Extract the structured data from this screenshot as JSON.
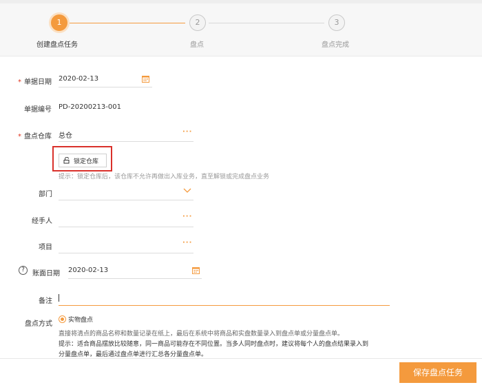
{
  "steps": [
    {
      "number": "1",
      "label": "创建盘点任务"
    },
    {
      "number": "2",
      "label": "盘点"
    },
    {
      "number": "3",
      "label": "盘点完成"
    }
  ],
  "colors": {
    "accent": "#f49a3d",
    "required": "#e0341e",
    "highlight": "#d9302a"
  },
  "form": {
    "required_mark": "*",
    "doc_date": {
      "label": "单据日期",
      "value": "2020-02-13",
      "icon": "calendar-icon"
    },
    "doc_no": {
      "label": "单据编号",
      "value": "PD-20200213-001"
    },
    "warehouse": {
      "label": "盘点仓库",
      "value": "总仓",
      "more": "···"
    },
    "lock_button": {
      "label": "锁定仓库",
      "icon": "lock-icon"
    },
    "lock_hint": "提示：锁定仓库后，该仓库不允许再做出入库业务，直至解锁或完成盘点业务",
    "department": {
      "label": "部门",
      "value": "",
      "icon": "chevron-down-icon"
    },
    "handler": {
      "label": "经手人",
      "value": "",
      "more": "···"
    },
    "project": {
      "label": "项目",
      "value": "",
      "more": "···"
    },
    "account_date": {
      "help": "?",
      "label": "账面日期",
      "value": "2020-02-13",
      "icon": "calendar-icon"
    },
    "remark": {
      "label": "备注",
      "value": ""
    },
    "method": {
      "label": "盘点方式",
      "option": "实物盘点",
      "desc1": "直接将清点的商品名称和数量记录在纸上，最后在系统中将商品和实盘数量录入到盘点单或分量盘点单。",
      "desc2": "提示：适合商品摆放比较随意，同一商品可能存在不同位置。当多人同时盘点时，建议将每个人的盘点结果录入到",
      "desc3": "分量盘点单，最后通过盘点单进行汇总各分量盘点单。"
    }
  },
  "footer": {
    "save_label": "保存盘点任务"
  }
}
